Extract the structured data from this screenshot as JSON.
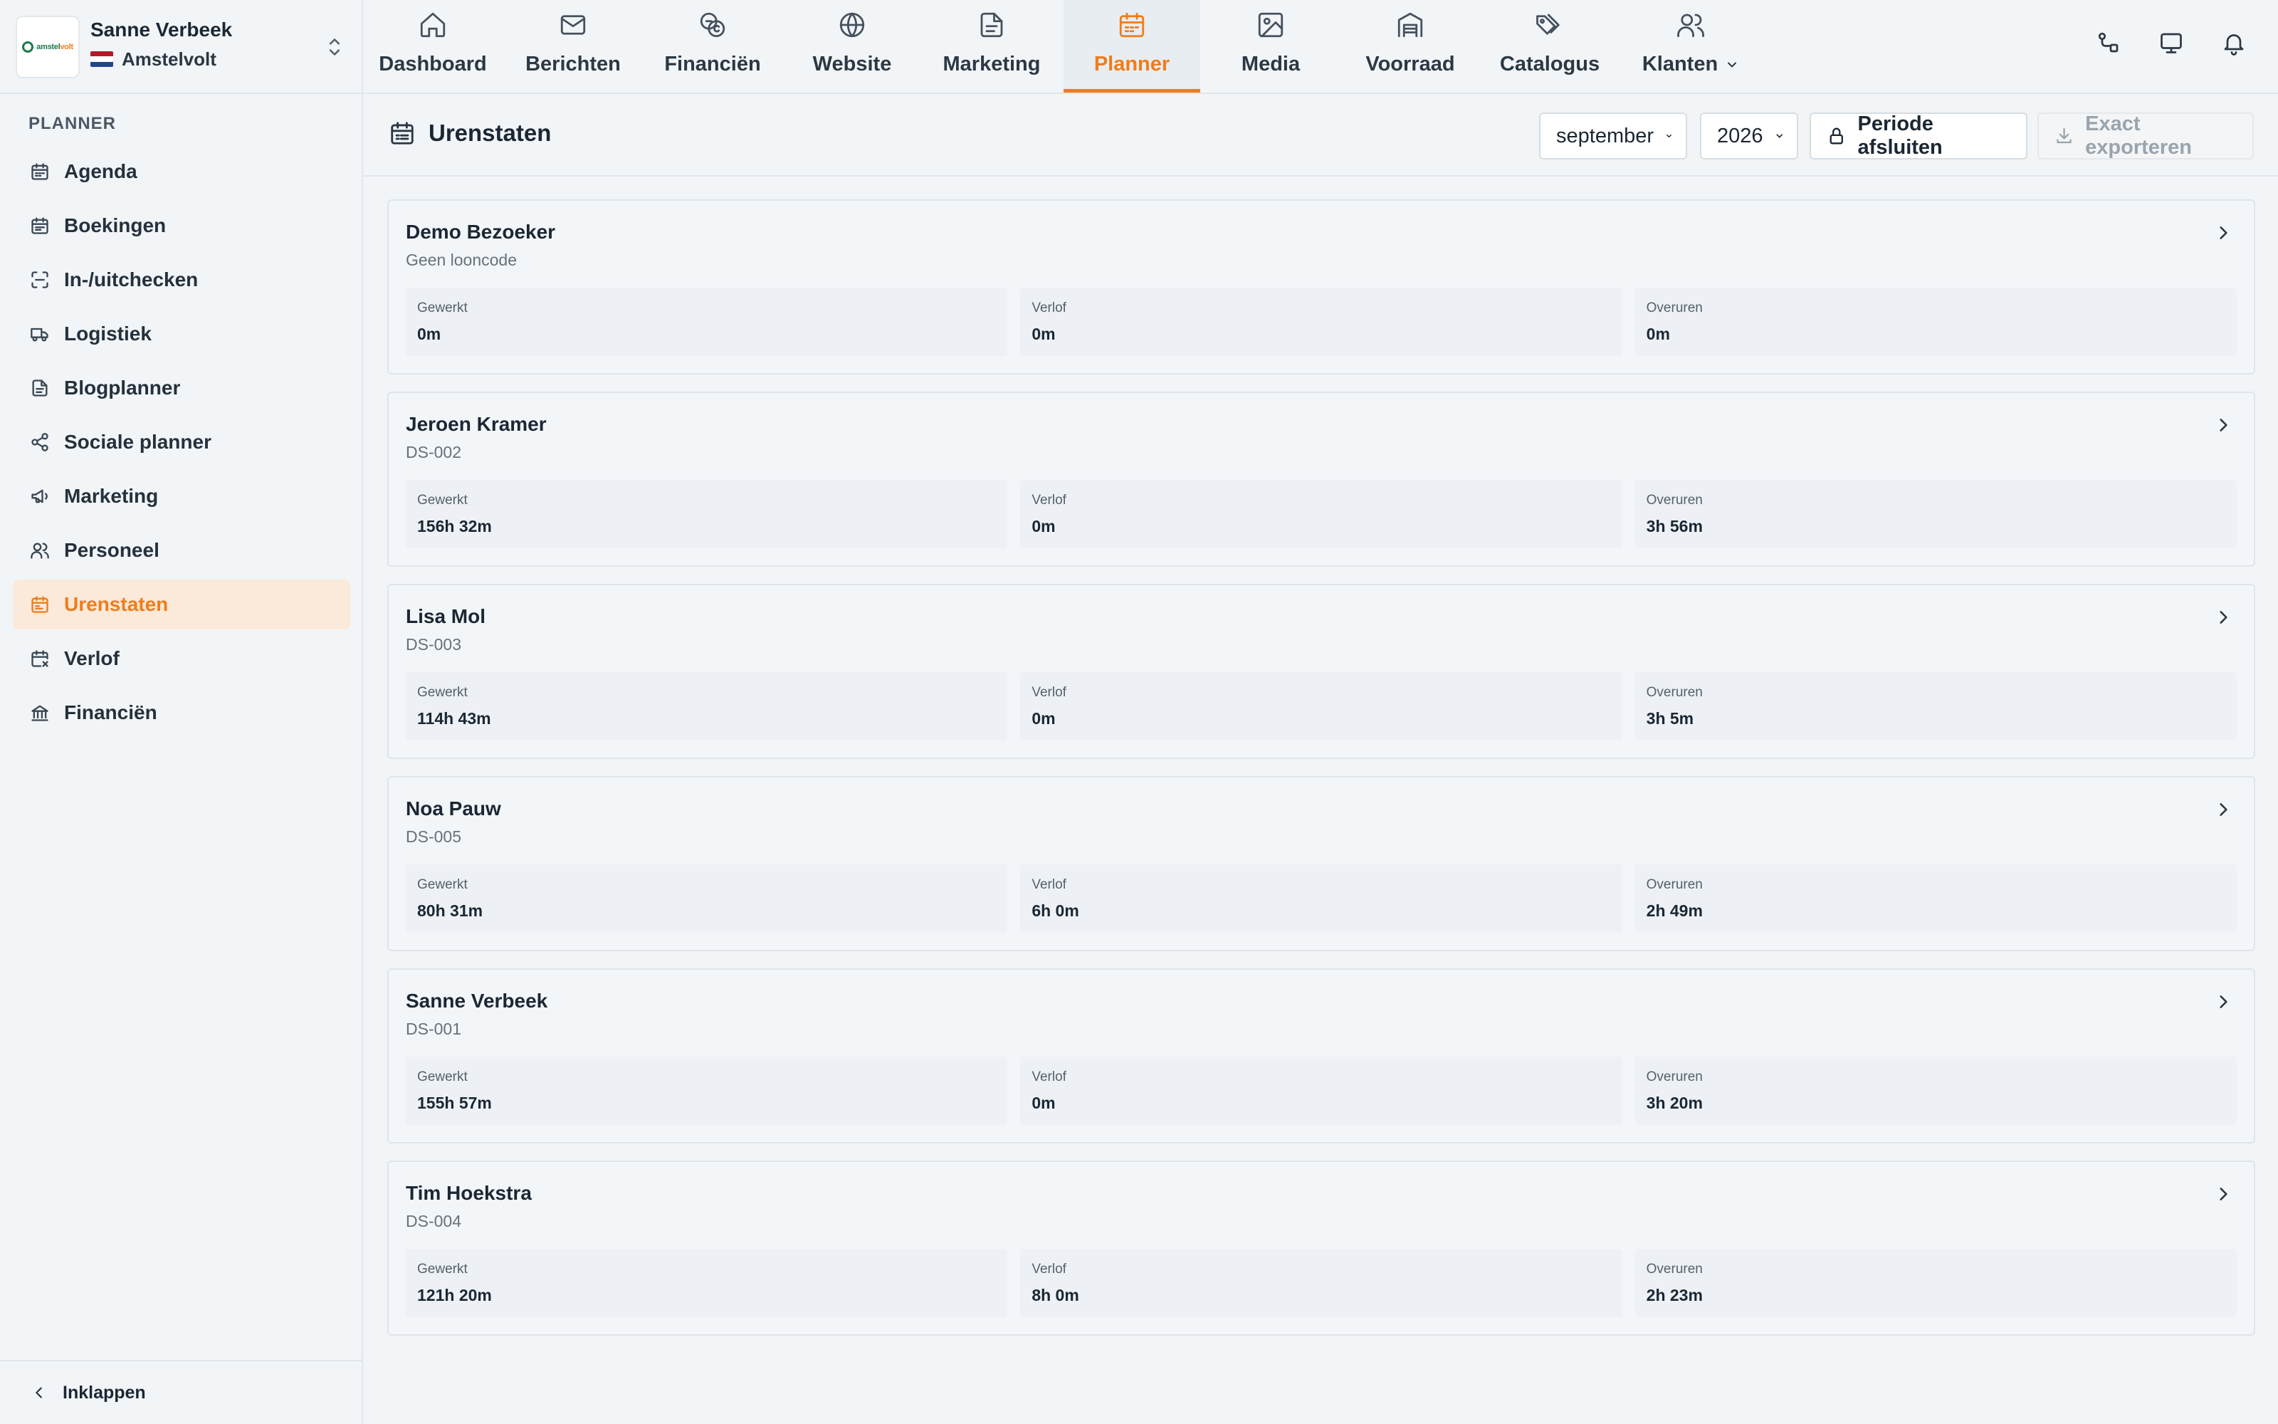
{
  "account": {
    "logo_text_main": "amstel",
    "logo_text_accent": "volt",
    "name": "Sanne Verbeek",
    "organization": "Amstelvolt"
  },
  "sidebar": {
    "section_title": "PLANNER",
    "items": [
      {
        "label": "Agenda",
        "icon": "calendar-icon"
      },
      {
        "label": "Boekingen",
        "icon": "calendar-grid-icon"
      },
      {
        "label": "In-/uitchecken",
        "icon": "scan-icon"
      },
      {
        "label": "Logistiek",
        "icon": "truck-icon"
      },
      {
        "label": "Blogplanner",
        "icon": "document-icon"
      },
      {
        "label": "Sociale planner",
        "icon": "share-icon"
      },
      {
        "label": "Marketing",
        "icon": "megaphone-icon"
      },
      {
        "label": "Personeel",
        "icon": "users-icon"
      },
      {
        "label": "Urenstaten",
        "icon": "timesheet-icon",
        "active": true
      },
      {
        "label": "Verlof",
        "icon": "calendar-off-icon"
      },
      {
        "label": "Financiën",
        "icon": "bank-icon"
      }
    ],
    "collapse_label": "Inklappen"
  },
  "topnav": {
    "tabs": [
      {
        "label": "Dashboard",
        "icon": "home-icon"
      },
      {
        "label": "Berichten",
        "icon": "mail-icon"
      },
      {
        "label": "Financiën",
        "icon": "coins-icon"
      },
      {
        "label": "Website",
        "icon": "globe-icon"
      },
      {
        "label": "Marketing",
        "icon": "file-icon"
      },
      {
        "label": "Planner",
        "icon": "calendar-icon",
        "active": true
      },
      {
        "label": "Media",
        "icon": "image-icon"
      },
      {
        "label": "Voorraad",
        "icon": "warehouse-icon"
      },
      {
        "label": "Catalogus",
        "icon": "tags-icon"
      },
      {
        "label": "Klanten",
        "icon": "users-icon",
        "has_dropdown": true
      }
    ],
    "right_icons": [
      "workflow-icon",
      "monitor-icon",
      "bell-icon"
    ]
  },
  "page": {
    "title": "Urenstaten",
    "month_select": "september",
    "year_select": "2026",
    "close_period_label": "Periode afsluiten",
    "export_label": "Exact exporteren",
    "export_disabled": true
  },
  "timesheets": {
    "labels": {
      "worked": "Gewerkt",
      "leave": "Verlof",
      "overtime": "Overuren"
    },
    "rows": [
      {
        "name": "Demo Bezoeker",
        "code": "Geen looncode",
        "worked": "0m",
        "leave": "0m",
        "overtime": "0m"
      },
      {
        "name": "Jeroen Kramer",
        "code": "DS-002",
        "worked": "156h 32m",
        "leave": "0m",
        "overtime": "3h 56m"
      },
      {
        "name": "Lisa Mol",
        "code": "DS-003",
        "worked": "114h 43m",
        "leave": "0m",
        "overtime": "3h 5m"
      },
      {
        "name": "Noa Pauw",
        "code": "DS-005",
        "worked": "80h 31m",
        "leave": "6h 0m",
        "overtime": "2h 49m"
      },
      {
        "name": "Sanne Verbeek",
        "code": "DS-001",
        "worked": "155h 57m",
        "leave": "0m",
        "overtime": "3h 20m"
      },
      {
        "name": "Tim Hoekstra",
        "code": "DS-004",
        "worked": "121h 20m",
        "leave": "8h 0m",
        "overtime": "2h 23m"
      }
    ]
  },
  "colors": {
    "accent": "#ef7d1b",
    "active_bg": "#fbe9da",
    "background": "#f2f5f8"
  }
}
